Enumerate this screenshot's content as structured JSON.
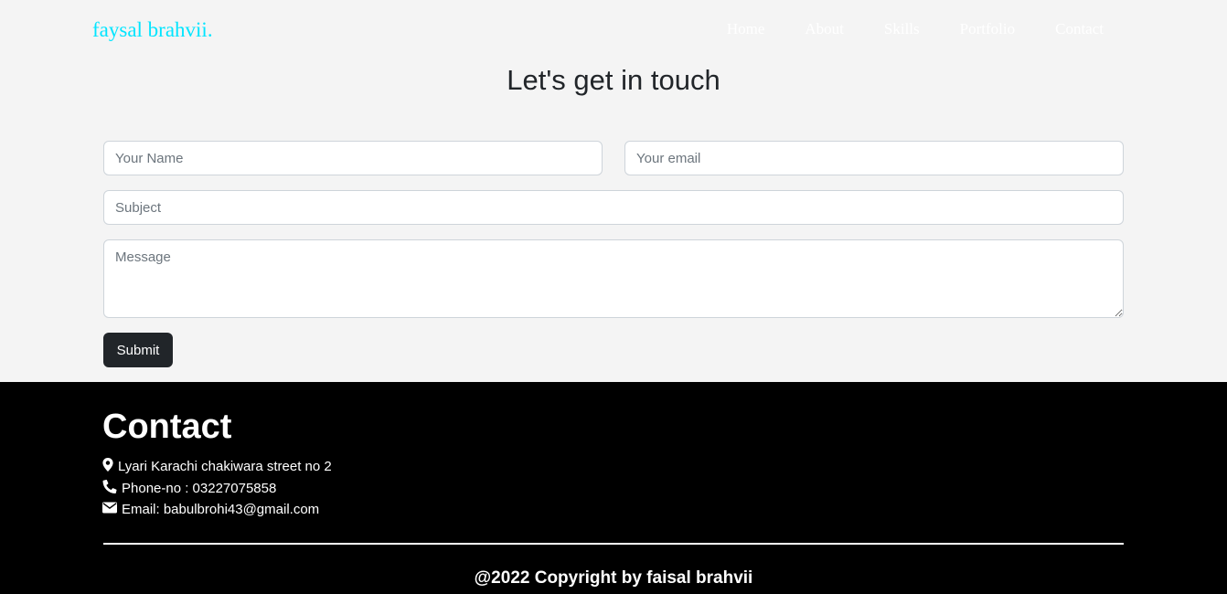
{
  "brand": {
    "name": "faysal brahvii.",
    "color": "#00e5ff"
  },
  "nav": {
    "items": [
      {
        "label": "Home"
      },
      {
        "label": "About"
      },
      {
        "label": "Skills"
      },
      {
        "label": "Portfolio"
      },
      {
        "label": "Contact"
      }
    ]
  },
  "form": {
    "title": "Let's get in touch",
    "name_placeholder": "Your Name",
    "email_placeholder": "Your email",
    "subject_placeholder": "Subject",
    "message_placeholder": "Message",
    "submit_label": "Submit"
  },
  "footer": {
    "heading": "Contact",
    "address": "Lyari Karachi chakiwara street no 2",
    "address_icon": "map-marker-icon",
    "phone": "Phone-no : 03227075858",
    "phone_icon": "phone-icon",
    "email": "Email: babulbrohi43@gmail.com",
    "email_icon": "envelope-icon",
    "copyright": "@2022 Copyright by faisal brahvii"
  }
}
